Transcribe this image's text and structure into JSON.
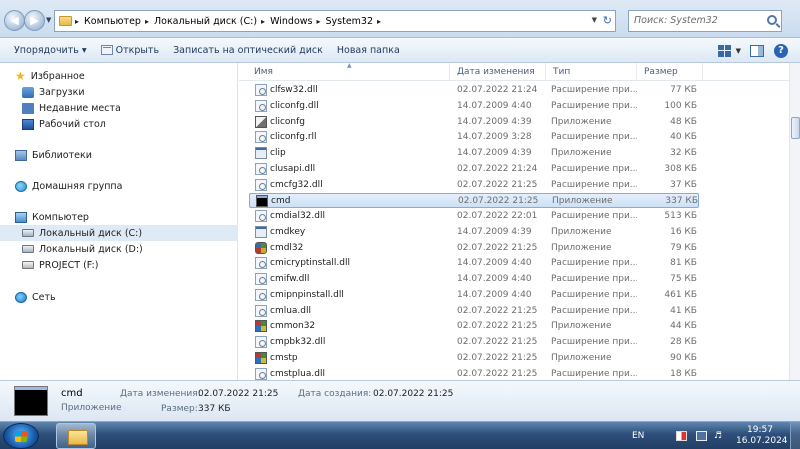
{
  "address": {
    "breadcrumbs": [
      "Компьютер",
      "Локальный диск (C:)",
      "Windows",
      "System32"
    ],
    "search_placeholder": "Поиск: System32"
  },
  "toolbar": {
    "organize": "Упорядочить ▾",
    "open": "Открыть",
    "burn": "Записать на оптический диск",
    "new_folder": "Новая папка"
  },
  "nav": {
    "favorites": "Избранное",
    "downloads": "Загрузки",
    "recent": "Недавние места",
    "desktop": "Рабочий стол",
    "libraries": "Библиотеки",
    "homegroup": "Домашняя группа",
    "computer": "Компьютер",
    "drive_c": "Локальный диск (C:)",
    "drive_d": "Локальный диск (D:)",
    "drive_f": "PROJECT (F:)",
    "network": "Сеть"
  },
  "columns": {
    "name": "Имя",
    "date": "Дата изменения",
    "type": "Тип",
    "size": "Размер"
  },
  "files": [
    {
      "name": "clfsw32.dll",
      "date": "02.07.2022 21:24",
      "type": "Расширение при...",
      "size": "77 КБ",
      "icon": "dll-icon"
    },
    {
      "name": "cliconfg.dll",
      "date": "14.07.2009 4:40",
      "type": "Расширение при...",
      "size": "100 КБ",
      "icon": "dll-icon"
    },
    {
      "name": "cliconfg",
      "date": "14.07.2009 4:39",
      "type": "Приложение",
      "size": "48 КБ",
      "icon": "config-app-icon"
    },
    {
      "name": "cliconfg.rll",
      "date": "14.07.2009 3:28",
      "type": "Расширение при...",
      "size": "40 КБ",
      "icon": "dll-icon"
    },
    {
      "name": "clip",
      "date": "14.07.2009 4:39",
      "type": "Приложение",
      "size": "32 КБ",
      "icon": "app-icon"
    },
    {
      "name": "clusapi.dll",
      "date": "02.07.2022 21:24",
      "type": "Расширение при...",
      "size": "308 КБ",
      "icon": "dll-icon"
    },
    {
      "name": "cmcfg32.dll",
      "date": "02.07.2022 21:25",
      "type": "Расширение при...",
      "size": "37 КБ",
      "icon": "dll-icon"
    },
    {
      "name": "cmd",
      "date": "02.07.2022 21:25",
      "type": "Приложение",
      "size": "337 КБ",
      "icon": "cmd-icon",
      "selected": true
    },
    {
      "name": "cmdial32.dll",
      "date": "02.07.2022 22:01",
      "type": "Расширение при...",
      "size": "513 КБ",
      "icon": "dll-icon"
    },
    {
      "name": "cmdkey",
      "date": "14.07.2009 4:39",
      "type": "Приложение",
      "size": "16 КБ",
      "icon": "app-icon"
    },
    {
      "name": "cmdl32",
      "date": "02.07.2022 21:25",
      "type": "Приложение",
      "size": "79 КБ",
      "icon": "gear-app-icon"
    },
    {
      "name": "cmicryptinstall.dll",
      "date": "14.07.2009 4:40",
      "type": "Расширение при...",
      "size": "81 КБ",
      "icon": "dll-icon"
    },
    {
      "name": "cmifw.dll",
      "date": "14.07.2009 4:40",
      "type": "Расширение при...",
      "size": "75 КБ",
      "icon": "dll-icon"
    },
    {
      "name": "cmipnpinstall.dll",
      "date": "14.07.2009 4:40",
      "type": "Расширение при...",
      "size": "461 КБ",
      "icon": "dll-icon"
    },
    {
      "name": "cmlua.dll",
      "date": "02.07.2022 21:25",
      "type": "Расширение при...",
      "size": "41 КБ",
      "icon": "dll-icon"
    },
    {
      "name": "cmmon32",
      "date": "02.07.2022 21:25",
      "type": "Приложение",
      "size": "44 КБ",
      "icon": "color-app-icon"
    },
    {
      "name": "cmpbk32.dll",
      "date": "02.07.2022 21:25",
      "type": "Расширение при...",
      "size": "28 КБ",
      "icon": "dll-icon"
    },
    {
      "name": "cmstp",
      "date": "02.07.2022 21:25",
      "type": "Приложение",
      "size": "90 КБ",
      "icon": "color-app-icon"
    },
    {
      "name": "cmstplua.dll",
      "date": "02.07.2022 21:25",
      "type": "Расширение при...",
      "size": "18 КБ",
      "icon": "dll-icon"
    }
  ],
  "details": {
    "name": "cmd",
    "type": "Приложение",
    "modified_label": "Дата изменения:",
    "modified_value": "02.07.2022 21:25",
    "created_label": "Дата создания:",
    "created_value": "02.07.2022 21:25",
    "size_label": "Размер:",
    "size_value": "337 КБ"
  },
  "taskbar": {
    "lang": "EN",
    "time": "19:57",
    "date": "16.07.2024"
  },
  "colors": {
    "selection": "#cde0f5",
    "taskbar": "#2d4f7a"
  }
}
